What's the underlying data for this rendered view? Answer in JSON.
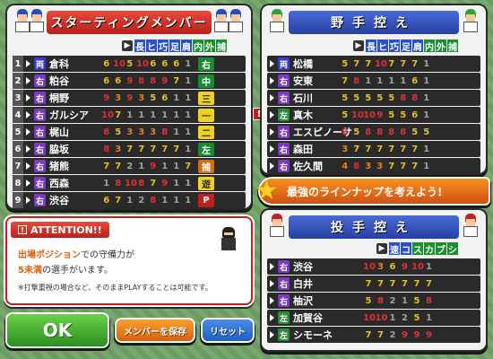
{
  "starting": {
    "title": "スターティングメンバー",
    "headers": [
      "長",
      "ヒ",
      "巧",
      "足",
      "肩",
      "内",
      "外",
      "捕"
    ],
    "rows": [
      {
        "num": "1",
        "hand": "両",
        "name": "倉科",
        "stats": [
          "6",
          "10",
          "5",
          "10",
          "6",
          "6",
          "6",
          "1"
        ],
        "pos": "右",
        "posColor": "green"
      },
      {
        "num": "2",
        "hand": "右",
        "name": "粕谷",
        "stats": [
          "6",
          "6",
          "9",
          "8",
          "8",
          "9",
          "7",
          "1"
        ],
        "pos": "中",
        "posColor": "green"
      },
      {
        "num": "3",
        "hand": "右",
        "name": "桐野",
        "stats": [
          "9",
          "3",
          "9",
          "3",
          "5",
          "6",
          "1",
          "1"
        ],
        "pos": "三",
        "posColor": "yellow"
      },
      {
        "num": "4",
        "hand": "右",
        "name": "ガルシア",
        "stats": [
          "10",
          "7",
          "1",
          "1",
          "1",
          "1",
          "1",
          "1"
        ],
        "pos": "一",
        "posColor": "yellow"
      },
      {
        "num": "5",
        "hand": "右",
        "name": "梶山",
        "stats": [
          "8",
          "5",
          "3",
          "3",
          "3",
          "8",
          "1",
          "1"
        ],
        "pos": "二",
        "posColor": "yellow"
      },
      {
        "num": "6",
        "hand": "右",
        "name": "脇坂",
        "stats": [
          "8",
          "3",
          "7",
          "7",
          "7",
          "7",
          "7",
          "1"
        ],
        "pos": "左",
        "posColor": "green"
      },
      {
        "num": "7",
        "hand": "右",
        "name": "猪熊",
        "stats": [
          "7",
          "7",
          "2",
          "1",
          "9",
          "1",
          "1",
          "7"
        ],
        "pos": "捕",
        "posColor": "orange"
      },
      {
        "num": "8",
        "hand": "右",
        "name": "西森",
        "stats": [
          "1",
          "8",
          "10",
          "8",
          "7",
          "9",
          "1",
          "1"
        ],
        "pos": "遊",
        "posColor": "yellow"
      },
      {
        "num": "9",
        "hand": "右",
        "name": "渋谷",
        "stats": [
          "6",
          "7",
          "1",
          "2",
          "8",
          "1",
          "1",
          "1"
        ],
        "pos": "P",
        "posColor": "red"
      }
    ]
  },
  "bench_fielders": {
    "title": "野手控え",
    "headers": [
      "長",
      "ヒ",
      "巧",
      "足",
      "肩",
      "内",
      "外",
      "捕"
    ],
    "rows": [
      {
        "hand": "両",
        "name": "松橋",
        "stats": [
          "5",
          "7",
          "7",
          "10",
          "7",
          "7",
          "7",
          "1"
        ]
      },
      {
        "hand": "右",
        "name": "安東",
        "stats": [
          "7",
          "8",
          "1",
          "1",
          "1",
          "1",
          "6",
          "1"
        ]
      },
      {
        "hand": "右",
        "name": "石川",
        "stats": [
          "5",
          "5",
          "5",
          "5",
          "5",
          "8",
          "8",
          "1"
        ]
      },
      {
        "hand": "左",
        "name": "真木",
        "stats": [
          "5",
          "10",
          "10",
          "9",
          "5",
          "5",
          "6",
          "1"
        ]
      },
      {
        "hand": "右",
        "name": "エスピノーサ",
        "stats": [
          "8",
          "5",
          "8",
          "8",
          "8",
          "8",
          "5",
          "5"
        ]
      },
      {
        "hand": "右",
        "name": "森田",
        "stats": [
          "3",
          "7",
          "7",
          "7",
          "7",
          "7",
          "7",
          "1"
        ]
      },
      {
        "hand": "右",
        "name": "佐久間",
        "stats": [
          "4",
          "8",
          "3",
          "3",
          "7",
          "7",
          "7",
          "1"
        ]
      }
    ]
  },
  "banner": "最強のラインナップを考えよう!",
  "bench_pitchers": {
    "title": "投手控え",
    "headers": [
      "速",
      "コ",
      "ス",
      "カ",
      "ブ",
      "シ"
    ],
    "rows": [
      {
        "hand": "右",
        "name": "渋谷",
        "stats": [
          "10",
          "3",
          "6",
          "9",
          "10",
          "1"
        ]
      },
      {
        "hand": "右",
        "name": "白井",
        "stats": [
          "7",
          "7",
          "7",
          "7",
          "7",
          "7"
        ]
      },
      {
        "hand": "右",
        "name": "柚沢",
        "stats": [
          "5",
          "8",
          "2",
          "1",
          "5",
          "8"
        ]
      },
      {
        "hand": "左",
        "name": "加賀谷",
        "stats": [
          "10",
          "10",
          "1",
          "2",
          "5",
          "1"
        ]
      },
      {
        "hand": "左",
        "name": "シモーネ",
        "stats": [
          "7",
          "7",
          "2",
          "9",
          "9",
          "9"
        ]
      }
    ]
  },
  "attention": {
    "title": "ATTENTION!!",
    "line1_a": "出場ポジション",
    "line1_b": "での守備力が",
    "line2_a": "5未満",
    "line2_b": "の選手がいます。",
    "note": "※打撃重視の場合など、そのままPLAYすることは可能です。"
  },
  "buttons": {
    "ok": "OK",
    "save": "メンバーを保存",
    "reset": "リセット"
  },
  "warning_mark": "!"
}
